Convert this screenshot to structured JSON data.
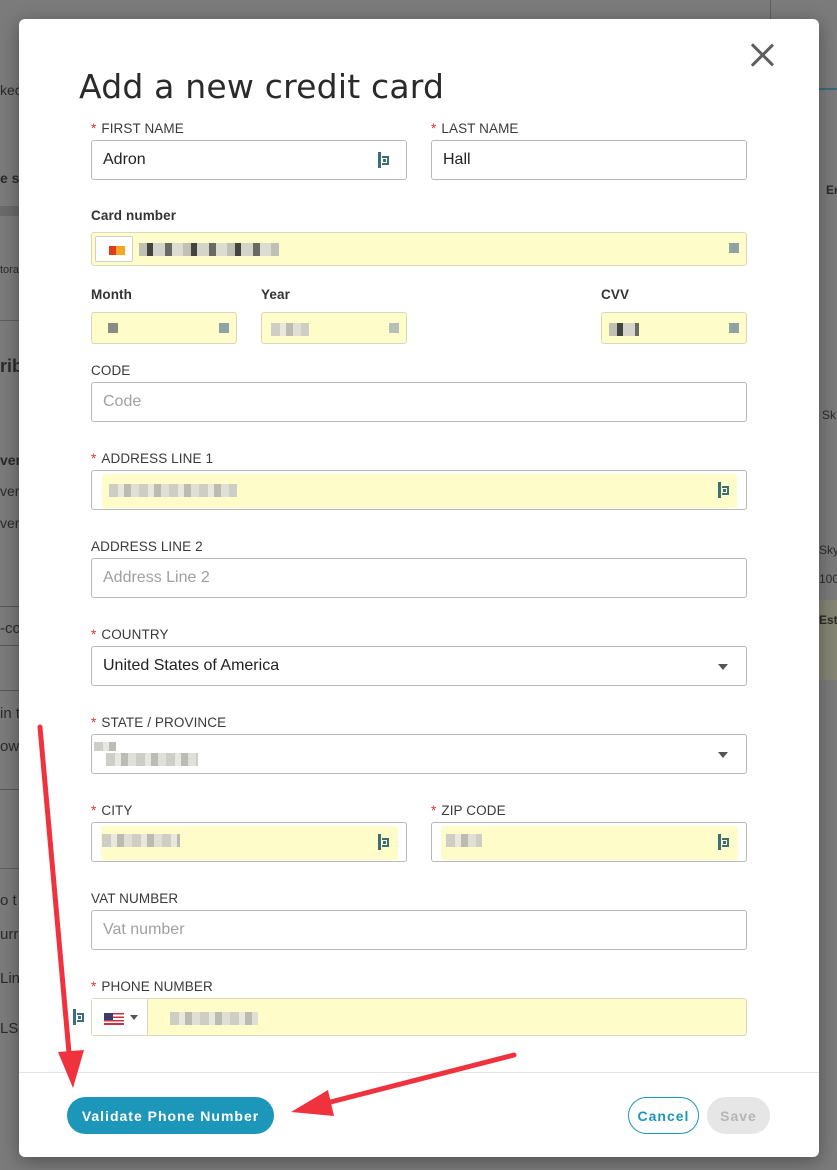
{
  "background": {
    "fragments": [
      "kec",
      "e s",
      "tora",
      "rib",
      "ver",
      "ver",
      "ver",
      "-co",
      "in t",
      "ow",
      "o t",
      "urre",
      "Lin",
      "LS",
      "En",
      "Sk",
      "Sky",
      "100",
      "Est"
    ]
  },
  "modal": {
    "title": "Add a new credit card",
    "close_label": "×"
  },
  "form": {
    "first_name": {
      "label": "FIRST NAME",
      "value": "Adron"
    },
    "last_name": {
      "label": "LAST NAME",
      "value": "Hall"
    },
    "card_number": {
      "label": "Card number"
    },
    "month": {
      "label": "Month"
    },
    "year": {
      "label": "Year"
    },
    "cvv": {
      "label": "CVV"
    },
    "code": {
      "label": "CODE",
      "placeholder": "Code"
    },
    "address_line_1": {
      "label": "ADDRESS LINE 1"
    },
    "address_line_2": {
      "label": "ADDRESS LINE 2",
      "placeholder": "Address Line 2"
    },
    "country": {
      "label": "COUNTRY",
      "value": "United States of America"
    },
    "state": {
      "label": "STATE / PROVINCE"
    },
    "city": {
      "label": "CITY"
    },
    "zip": {
      "label": "ZIP CODE"
    },
    "vat": {
      "label": "VAT NUMBER",
      "placeholder": "Vat number"
    },
    "phone": {
      "label": "PHONE NUMBER"
    },
    "required_marker": "*"
  },
  "footer": {
    "validate_label": "Validate Phone Number",
    "cancel_label": "Cancel",
    "save_label": "Save"
  },
  "colors": {
    "accent": "#1c96b9",
    "autofill": "#fefdc9",
    "required": "#e0322f",
    "annotation_arrow": "#f0323f"
  },
  "icons": [
    "close-icon",
    "password-manager-icon",
    "card-brand-icon",
    "dropdown-caret-icon",
    "us-flag-icon",
    "annotation-arrow-icon"
  ]
}
